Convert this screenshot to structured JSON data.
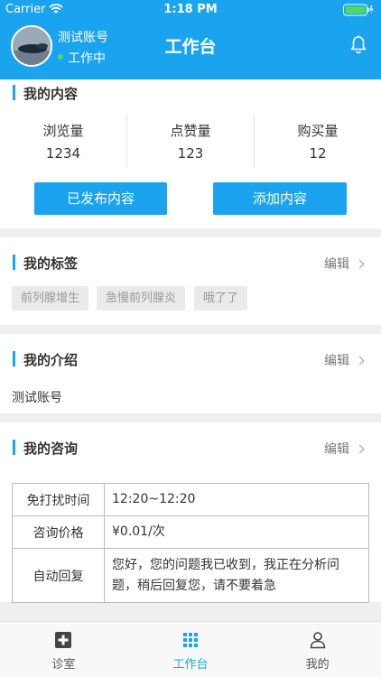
{
  "status_bar": {
    "carrier": "Carrier",
    "time": "1:18 PM"
  },
  "header": {
    "user_name": "测试账号",
    "user_status": "工作中",
    "title": "工作台"
  },
  "content": {
    "title": "我的内容",
    "stats": [
      {
        "label": "浏览量",
        "value": "1234"
      },
      {
        "label": "点赞量",
        "value": "123"
      },
      {
        "label": "购买量",
        "value": "12"
      }
    ],
    "published_button": "已发布内容",
    "add_button": "添加内容"
  },
  "tags": {
    "title": "我的标签",
    "edit": "编辑",
    "items": [
      "前列腺增生",
      "急慢前列腺炎",
      "哦了了"
    ]
  },
  "intro": {
    "title": "我的介绍",
    "edit": "编辑",
    "text": "测试账号"
  },
  "consult": {
    "title": "我的咨询",
    "edit": "编辑",
    "rows": [
      {
        "key": "免打扰时间",
        "value": "12:20~12:20"
      },
      {
        "key": "咨询价格",
        "value": "¥0.01/次"
      },
      {
        "key": "自动回复",
        "value": "您好，您的问题我已收到，我正在分析问题，稍后回复您，请不要着急"
      }
    ]
  },
  "tabbar": {
    "items": [
      {
        "label": "诊室",
        "icon": "medical-cross-icon"
      },
      {
        "label": "工作台",
        "icon": "grid-icon",
        "active": true
      },
      {
        "label": "我的",
        "icon": "person-icon"
      }
    ]
  },
  "colors": {
    "accent": "#1aa3ef",
    "status_online": "#4cd964"
  }
}
